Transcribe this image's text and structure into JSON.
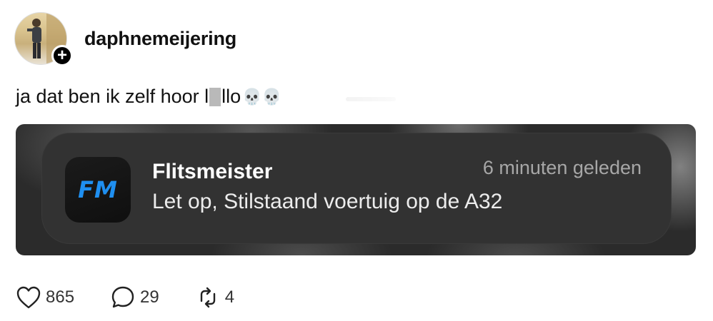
{
  "post": {
    "username": "daphnemeijering",
    "follow_icon": "plus-icon",
    "follow_symbol": "+",
    "caption_before": "ja dat ben ik zelf hoor l",
    "caption_after": "llo",
    "caption_emoji": "💀💀"
  },
  "notification": {
    "app_icon_text": "FM",
    "app_name": "Flitsmeister",
    "time": "6 minuten geleden",
    "message": "Let op, Stilstaand voertuig op de A32",
    "accent_color": "#1f8ff0"
  },
  "actions": {
    "likes": "865",
    "comments": "29",
    "reposts": "4"
  }
}
